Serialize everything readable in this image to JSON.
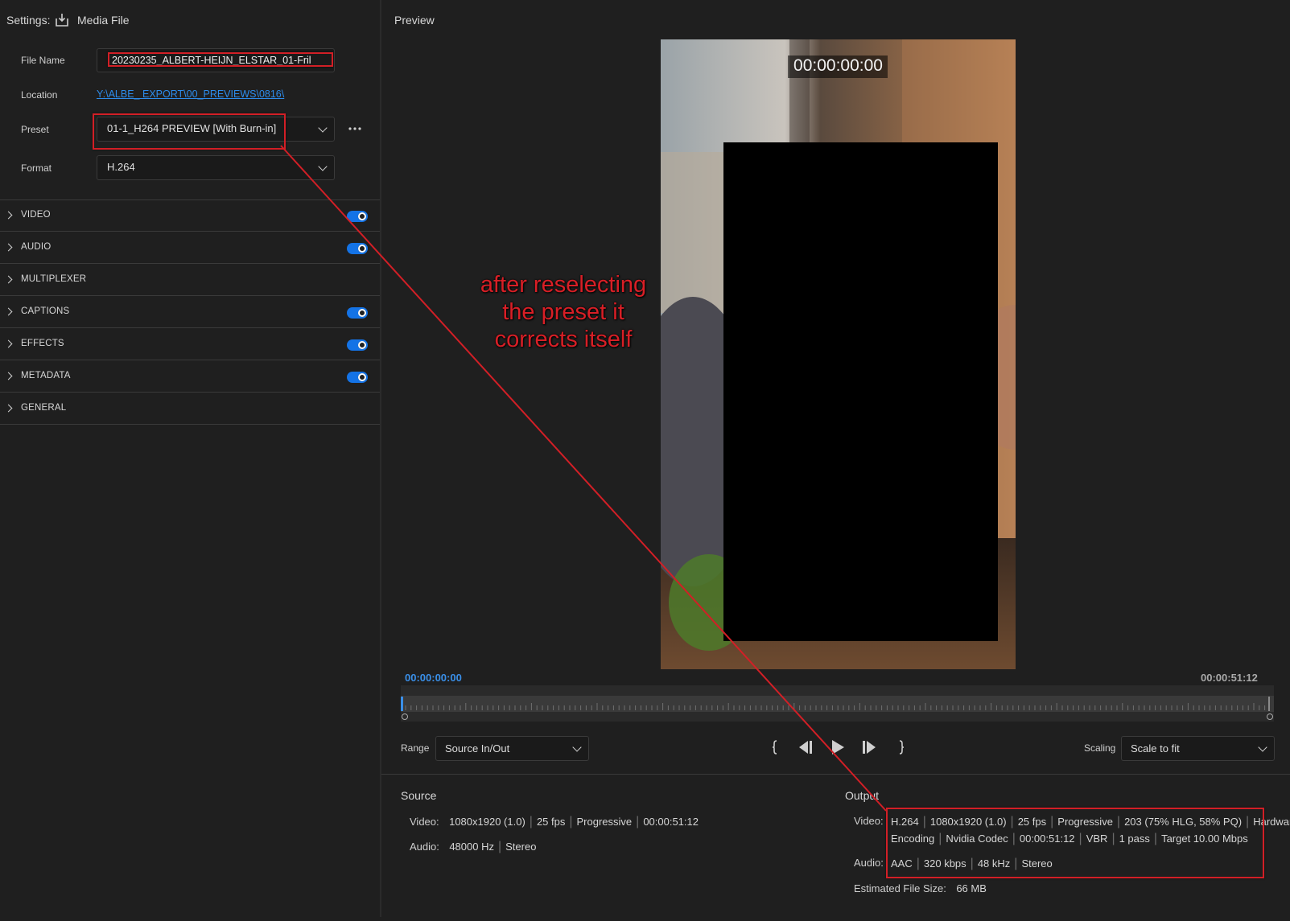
{
  "settings": {
    "label": "Settings:",
    "media_file_label": "Media File",
    "file_name_label": "File Name",
    "file_name_value": "20230235_ALBERT-HEIJN_ELSTAR_01-Fril",
    "location_label": "Location",
    "location_value": "Y:\\ALBE_ EXPORT\\00_PREVIEWS\\0816\\",
    "preset_label": "Preset",
    "preset_value": "01-1_H264 PREVIEW [With Burn-in]",
    "format_label": "Format",
    "format_value": "H.264",
    "sections": [
      {
        "title": "VIDEO",
        "toggle": true
      },
      {
        "title": "AUDIO",
        "toggle": true
      },
      {
        "title": "MULTIPLEXER",
        "toggle": false
      },
      {
        "title": "CAPTIONS",
        "toggle": true
      },
      {
        "title": "EFFECTS",
        "toggle": true
      },
      {
        "title": "METADATA",
        "toggle": true
      },
      {
        "title": "GENERAL",
        "toggle": false
      }
    ]
  },
  "preview": {
    "title": "Preview",
    "burn_in_timecode": "00:00:00:00",
    "current_time": "00:00:00:00",
    "end_time": "00:00:51:12",
    "range_label": "Range",
    "range_value": "Source In/Out",
    "scaling_label": "Scaling",
    "scaling_value": "Scale to fit"
  },
  "annotation": {
    "lines": [
      "after reselecting",
      "the preset it",
      "corrects itself"
    ],
    "color": "#d21f26"
  },
  "source": {
    "title": "Source",
    "video_label": "Video:",
    "video_parts": [
      "1080x1920 (1.0)",
      "25 fps",
      "Progressive",
      "00:00:51:12"
    ],
    "audio_label": "Audio:",
    "audio_parts": [
      "48000 Hz",
      "Stereo"
    ]
  },
  "output": {
    "title": "Output",
    "video_label": "Video:",
    "video_line1_parts": [
      "H.264",
      "1080x1920 (1.0)",
      "25 fps",
      "Progressive",
      "203 (75% HLG, 58% PQ)",
      "Hardware"
    ],
    "video_line2_parts": [
      "Encoding",
      "Nvidia Codec",
      "00:00:51:12",
      "VBR",
      "1 pass",
      "Target 10.00 Mbps"
    ],
    "audio_label": "Audio:",
    "audio_parts": [
      "AAC",
      "320 kbps",
      "48 kHz",
      "Stereo"
    ],
    "file_size_label": "Estimated File Size:",
    "file_size_value": "66 MB"
  },
  "colors": {
    "accent": "#1473e6",
    "link": "#2d8ceb",
    "timecode_blue": "#3a8fe8",
    "background": "#1f1f1f"
  }
}
